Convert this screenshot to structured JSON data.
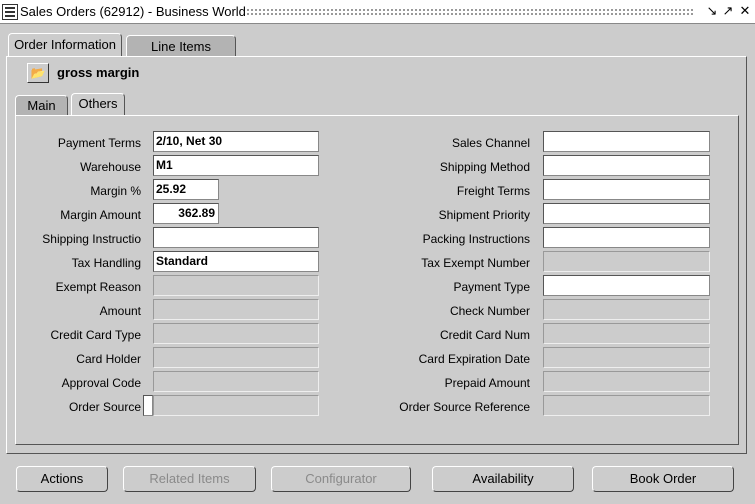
{
  "window": {
    "title": "Sales Orders (62912) - Business World",
    "app_icon": "oracle-forms-icon",
    "controls": [
      "minimize-icon",
      "maximize-icon",
      "close-icon"
    ]
  },
  "top_tabs": [
    {
      "label": "Order Information",
      "active": true
    },
    {
      "label": "Line Items",
      "active": false
    }
  ],
  "header": {
    "icon": "open-folder-icon",
    "title": "gross margin"
  },
  "sub_tabs": [
    {
      "label": "Main",
      "active": false
    },
    {
      "label": "Others",
      "active": true
    }
  ],
  "left_fields": [
    {
      "label": "Payment Terms",
      "value": "2/10, Net 30"
    },
    {
      "label": "Warehouse",
      "value": "M1"
    },
    {
      "label": "Margin %",
      "value": "25.92"
    },
    {
      "label": "Margin Amount",
      "value": "362.89"
    },
    {
      "label": "Shipping Instructio",
      "value": ""
    },
    {
      "label": "Tax Handling",
      "value": "Standard"
    },
    {
      "label": "Exempt Reason",
      "value": ""
    },
    {
      "label": "Amount",
      "value": ""
    },
    {
      "label": "Credit Card Type",
      "value": ""
    },
    {
      "label": "Card Holder",
      "value": ""
    },
    {
      "label": "Approval Code",
      "value": ""
    },
    {
      "label": "Order Source",
      "value": ""
    }
  ],
  "right_fields": [
    {
      "label": "Sales Channel",
      "value": ""
    },
    {
      "label": "Shipping Method",
      "value": ""
    },
    {
      "label": "Freight Terms",
      "value": ""
    },
    {
      "label": "Shipment Priority",
      "value": ""
    },
    {
      "label": "Packing Instructions",
      "value": ""
    },
    {
      "label": "Tax Exempt Number",
      "value": ""
    },
    {
      "label": "Payment Type",
      "value": ""
    },
    {
      "label": "Check Number",
      "value": ""
    },
    {
      "label": "Credit Card Num",
      "value": ""
    },
    {
      "label": "Card Expiration Date",
      "value": ""
    },
    {
      "label": "Prepaid Amount",
      "value": ""
    },
    {
      "label": "Order Source Reference",
      "value": ""
    }
  ],
  "buttons": [
    {
      "label": "Actions",
      "enabled": true
    },
    {
      "label": "Related Items",
      "enabled": false
    },
    {
      "label": "Configurator",
      "enabled": false
    },
    {
      "label": "Availability",
      "enabled": true
    },
    {
      "label": "Book Order",
      "enabled": true
    }
  ]
}
